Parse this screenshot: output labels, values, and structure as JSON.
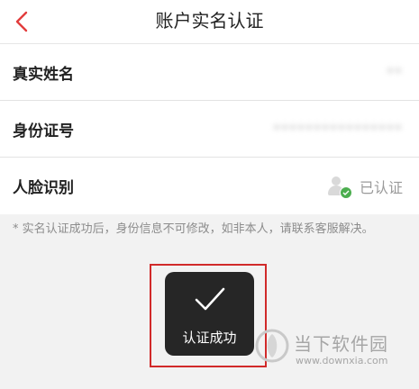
{
  "header": {
    "back_icon": "chevron-left-icon",
    "title": "账户实名认证"
  },
  "colors": {
    "accent": "#e23c3c",
    "verified_green": "#4cae4f",
    "highlight_border": "#d12a2a"
  },
  "form": {
    "rows": [
      {
        "label": "真实姓名",
        "value": "**"
      },
      {
        "label": "身份证号",
        "value": "****************"
      },
      {
        "label": "人脸识别",
        "value": "已认证",
        "icon": "face-verified-icon"
      }
    ]
  },
  "note": "* 实名认证成功后，身份信息不可修改，如非本人，请联系客服解决。",
  "toast": {
    "icon": "checkmark-icon",
    "text": "认证成功"
  },
  "watermark": {
    "name": "当下软件园",
    "url": "www.downxia.com"
  }
}
